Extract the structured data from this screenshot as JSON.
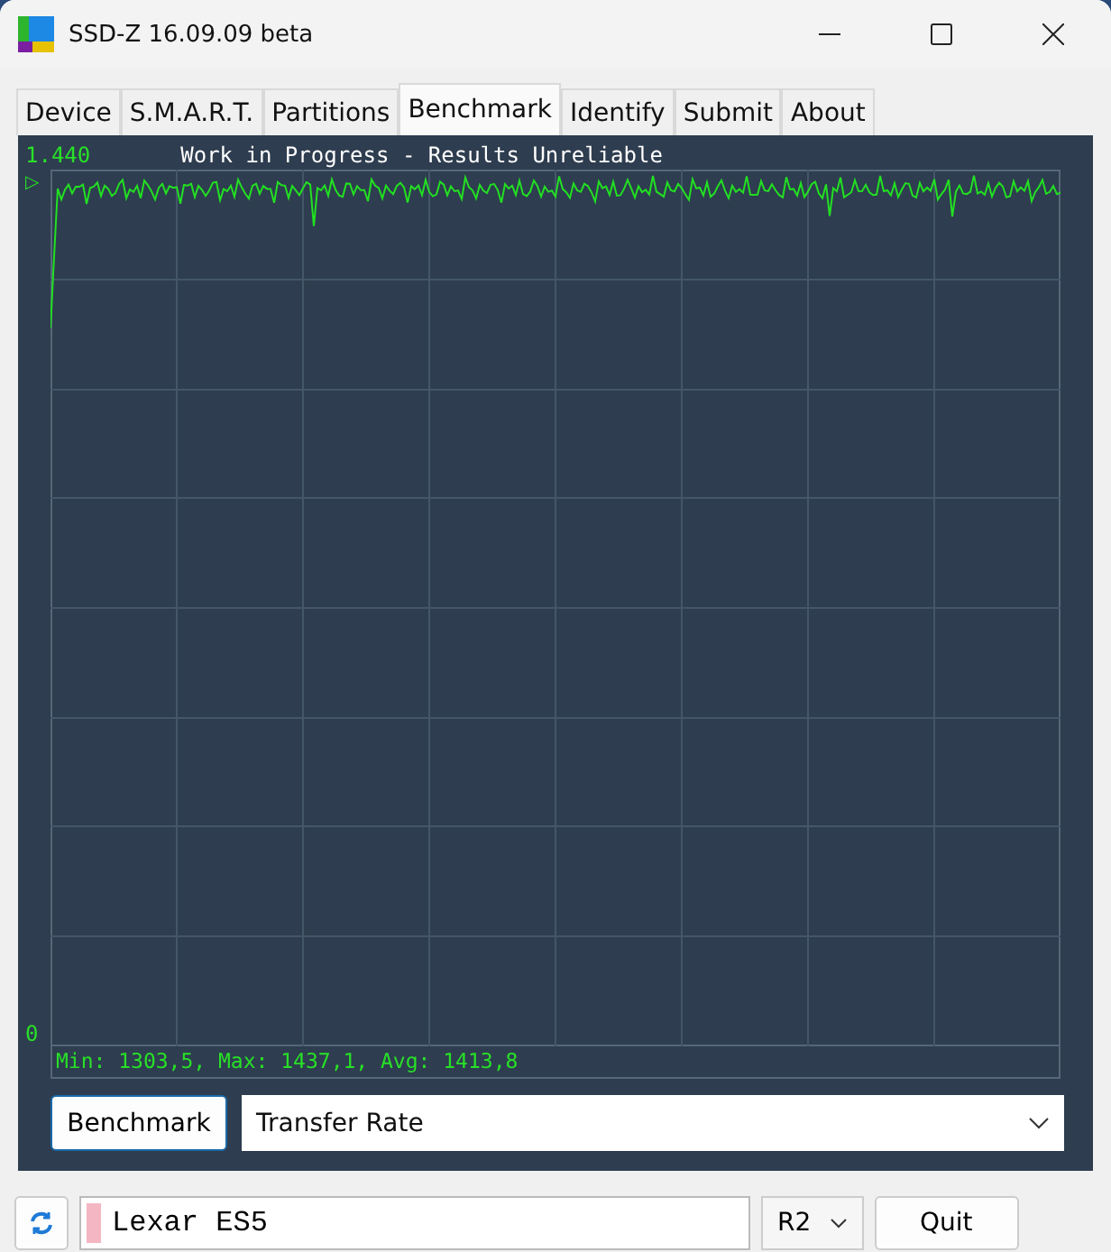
{
  "window": {
    "title": "SSD-Z 16.09.09 beta"
  },
  "tabs": [
    {
      "label": "Device",
      "selected": false
    },
    {
      "label": "S.M.A.R.T.",
      "selected": false
    },
    {
      "label": "Partitions",
      "selected": false
    },
    {
      "label": "Benchmark",
      "selected": true
    },
    {
      "label": "Identify",
      "selected": false
    },
    {
      "label": "Submit",
      "selected": false
    },
    {
      "label": "About",
      "selected": false
    }
  ],
  "graph": {
    "y_max_label": "1.440",
    "y_min_label": "0",
    "marker": "▷",
    "title": "Work in Progress - Results Unreliable",
    "stats": "Min: 1303,5, Max: 1437,1, Avg: 1413,8"
  },
  "controls": {
    "button": "Benchmark",
    "mode": "Transfer Rate"
  },
  "bottom_bar": {
    "drive": "Lexar ES5",
    "drive_letter": "R2",
    "quit": "Quit"
  }
}
